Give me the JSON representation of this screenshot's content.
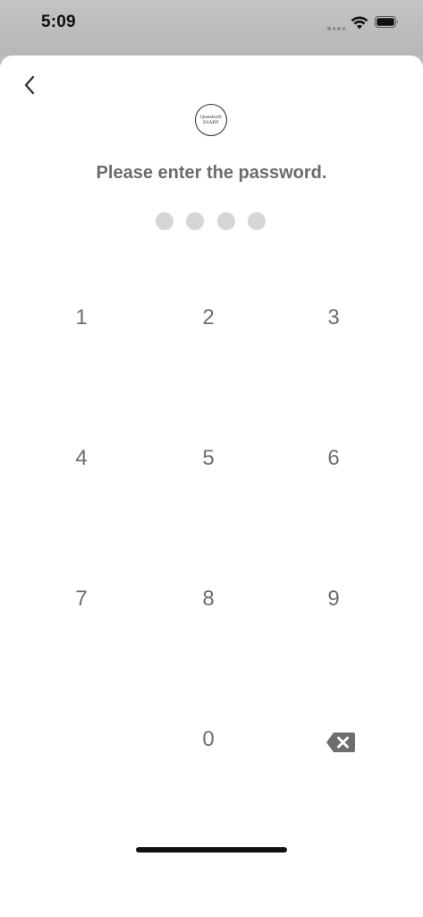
{
  "status_bar": {
    "time": "5:09",
    "icons": [
      "cellular-signal-icon",
      "wifi-icon",
      "battery-icon"
    ]
  },
  "header": {
    "back_icon": "chevron-left-icon",
    "logo": {
      "line1": "QuestioN",
      "line2": "DIARY"
    }
  },
  "prompt": "Please enter the password.",
  "passcode": {
    "length": 4,
    "entered": 0
  },
  "keypad": {
    "keys": [
      "1",
      "2",
      "3",
      "4",
      "5",
      "6",
      "7",
      "8",
      "9",
      "",
      "0",
      "delete"
    ],
    "delete_icon": "backspace-icon"
  },
  "colors": {
    "text_gray": "#6e6e6e",
    "dot_empty": "#d6d6d6",
    "sheet_bg": "#ffffff",
    "backdrop": "#bdbdbb"
  }
}
